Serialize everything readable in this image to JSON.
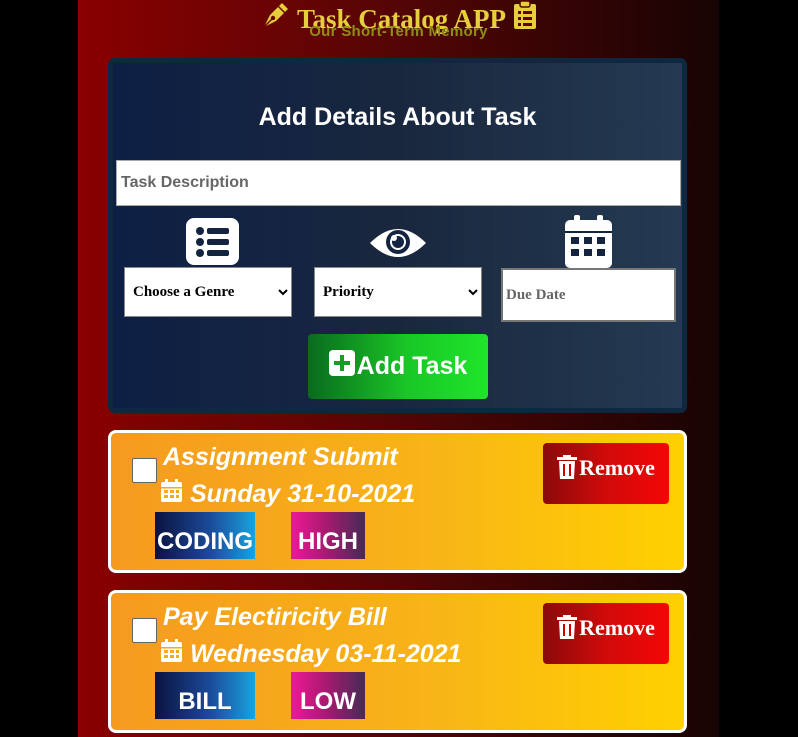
{
  "header": {
    "title": "Task Catalog APP",
    "subtitle": "Our Short-Term Memory",
    "title_color": "#e5cf3a",
    "subtitle_color": "#8f8e17",
    "icons": [
      "pen-nib-icon",
      "clipboard-list-icon"
    ]
  },
  "form": {
    "heading": "Add Details About Task",
    "description_placeholder": "Task Description",
    "description_value": "",
    "genre_icon": "list-icon",
    "genre_selected": "Choose a Genre",
    "priority_icon": "eye-icon",
    "priority_selected": "Priority",
    "date_icon": "calendar-icon",
    "due_date_placeholder": "Due Date",
    "add_button_label": "Add Task",
    "add_button_icon": "plus-square-icon"
  },
  "tasks": [
    {
      "title": "Assignment Submit",
      "due": "Sunday 31-10-2021",
      "genre": "CODING",
      "priority": "HIGH",
      "checked": false,
      "remove_label": "Remove"
    },
    {
      "title": "Pay Electiricity Bill",
      "due": "Wednesday 03-11-2021",
      "genre": "BILL",
      "priority": "LOW",
      "checked": false,
      "remove_label": "Remove"
    }
  ]
}
